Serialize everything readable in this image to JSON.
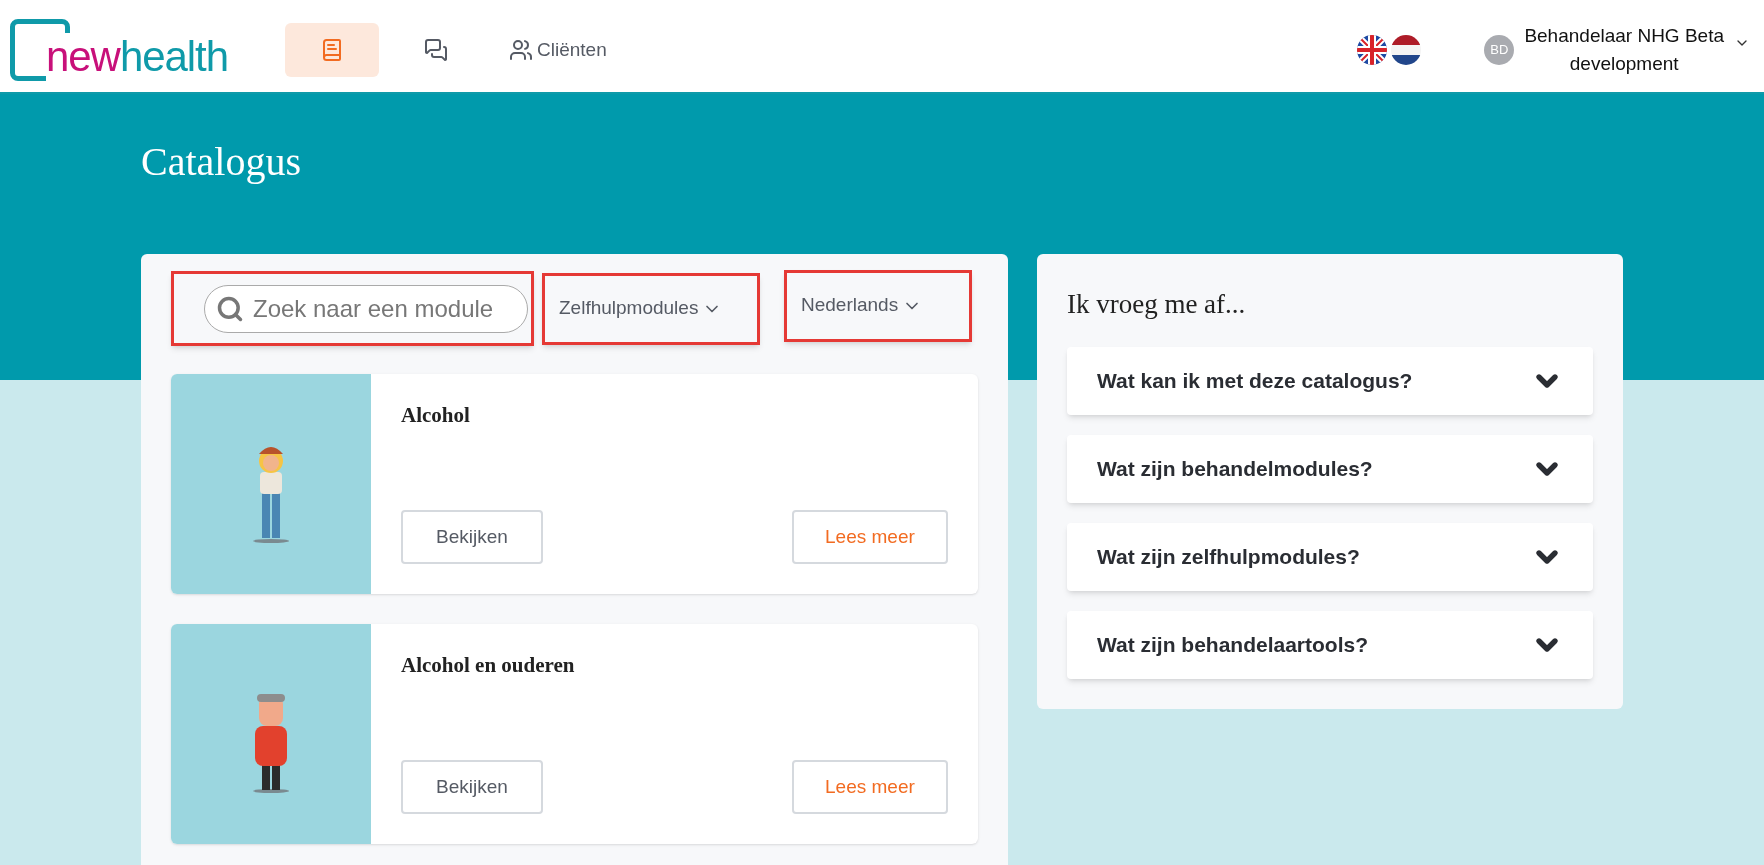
{
  "header": {
    "logo": {
      "part_1": "new",
      "part_2": "health"
    },
    "nav": [
      {
        "kind": "book",
        "selected": true
      },
      {
        "kind": "chat",
        "selected": false
      },
      {
        "kind": "users",
        "label": "Cliënten",
        "selected": false
      }
    ],
    "languages": [
      {
        "kind": "en"
      },
      {
        "kind": "nl"
      }
    ],
    "user": {
      "initials": "BD",
      "name_line_1": "Behandelaar NHG Beta",
      "name_line_2": "development"
    }
  },
  "page_title": "Catalogus",
  "filters": {
    "search": {
      "placeholder": "Zoek naar een module",
      "highlighted": true
    },
    "dropdowns": [
      {
        "value": "Zelfhulpmodules",
        "highlighted": true
      },
      {
        "value": "Nederlands",
        "highlighted": true
      }
    ]
  },
  "modules": [
    {
      "title": "Alcohol",
      "kind": "picture",
      "buttons": [
        "Bekijken",
        "Lees meer"
      ]
    },
    {
      "title": "Alcohol en ouderen",
      "kind": "picture",
      "buttons": [
        "Bekijken",
        "Lees meer"
      ]
    }
  ],
  "faq": {
    "title": "Ik vroeg me af...",
    "items": [
      {
        "question": "Wat kan ik met deze catalogus?",
        "expanded": false
      },
      {
        "question": "Wat zijn behandelmodules?",
        "expanded": false
      },
      {
        "question": "Wat zijn zelfhulpmodules?",
        "expanded": false
      },
      {
        "question": "Wat zijn behandelaartools?",
        "expanded": false
      }
    ]
  }
}
